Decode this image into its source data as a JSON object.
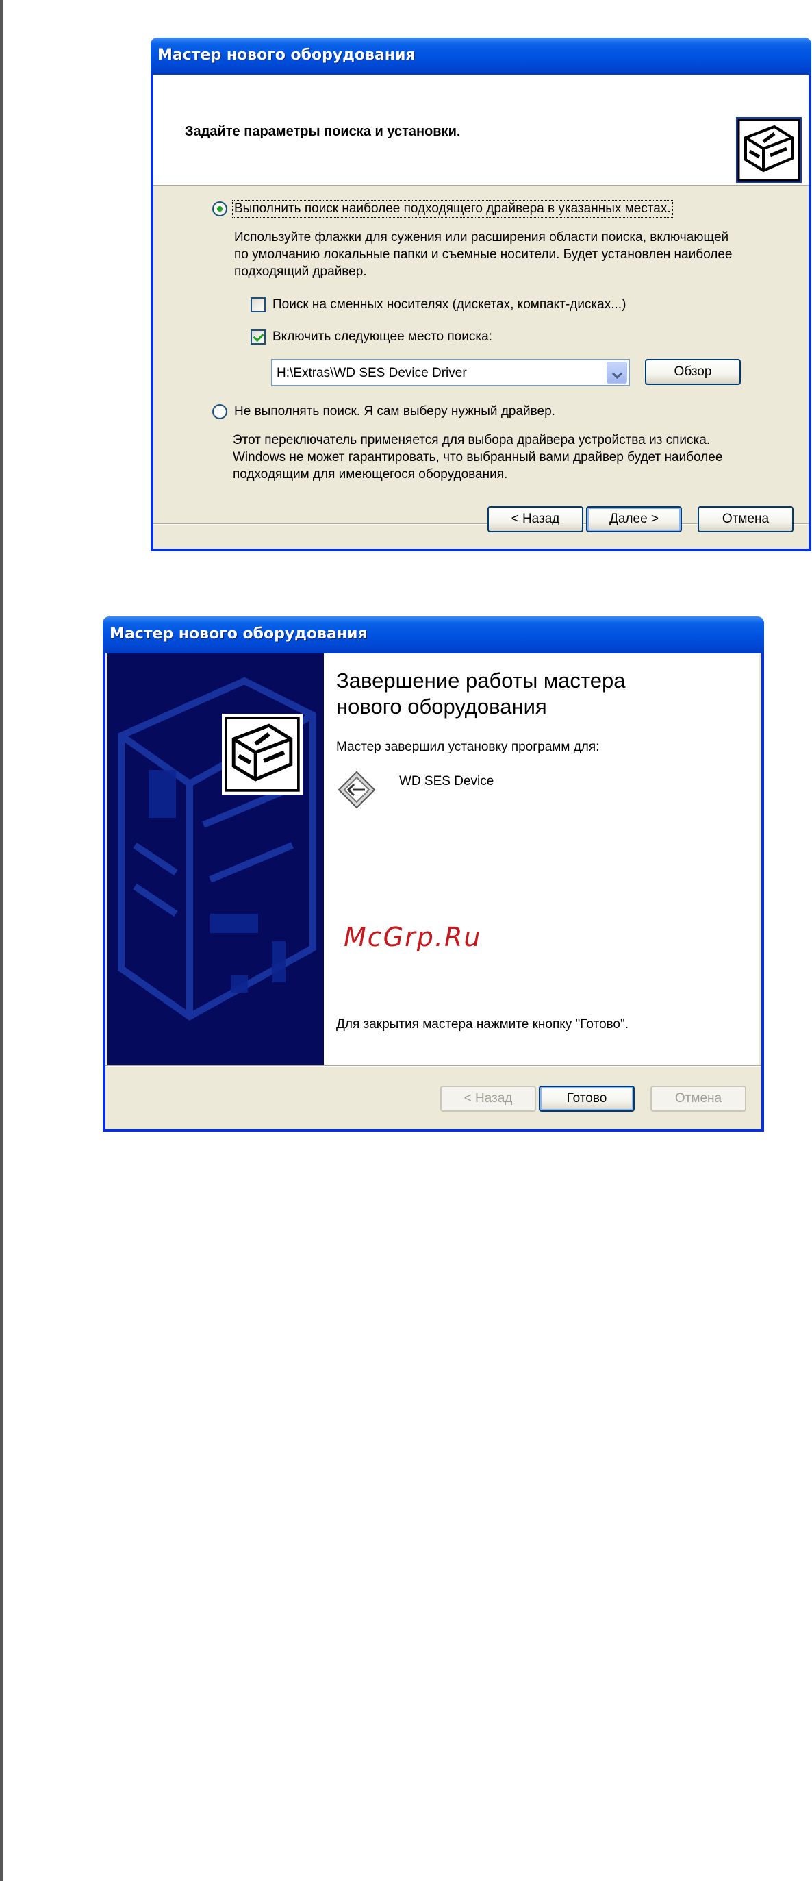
{
  "dialog1": {
    "title": "Мастер нового оборудования",
    "header_title": "Задайте параметры поиска и установки.",
    "option_search": {
      "label": "Выполнить поиск наиболее подходящего драйвера в указанных местах.",
      "selected": true,
      "description": [
        "Используйте флажки для сужения или расширения области поиска, включающей",
        "по умолчанию локальные папки и съемные носители. Будет установлен наиболее",
        "подходящий драйвер."
      ]
    },
    "check_removable": {
      "label": "Поиск на сменных носителях (дискетах, компакт-дисках...)",
      "checked": false
    },
    "check_location": {
      "label": "Включить следующее место поиска:",
      "checked": true
    },
    "location_value": "H:\\Extras\\WD SES Device Driver",
    "browse_label": "Обзор",
    "option_manual": {
      "label": "Не выполнять поиск. Я сам выберу нужный драйвер.",
      "selected": false,
      "description": [
        "Этот переключатель применяется для выбора драйвера устройства из списка.",
        "Windows не может гарантировать, что выбранный вами драйвер будет наиболее",
        "подходящим для имеющегося оборудования."
      ]
    },
    "buttons": {
      "back": "< Назад",
      "next": "Далее >",
      "cancel": "Отмена"
    }
  },
  "dialog2": {
    "title": "Мастер нового оборудования",
    "heading": [
      "Завершение работы мастера",
      "нового оборудования"
    ],
    "installed_caption": "Мастер завершил установку программ для:",
    "device_name": "WD SES Device",
    "watermark": "McGrp.Ru",
    "close_hint": "Для закрытия мастера нажмите кнопку \"Готово\".",
    "buttons": {
      "back": "< Назад",
      "finish": "Готово",
      "cancel": "Отмена"
    }
  },
  "colors": {
    "titlebar": "#0053e1",
    "dialog_bg": "#ece9d8",
    "sidebar": "#050a5c",
    "watermark": "#c7181e",
    "check_mark": "#21a121"
  }
}
